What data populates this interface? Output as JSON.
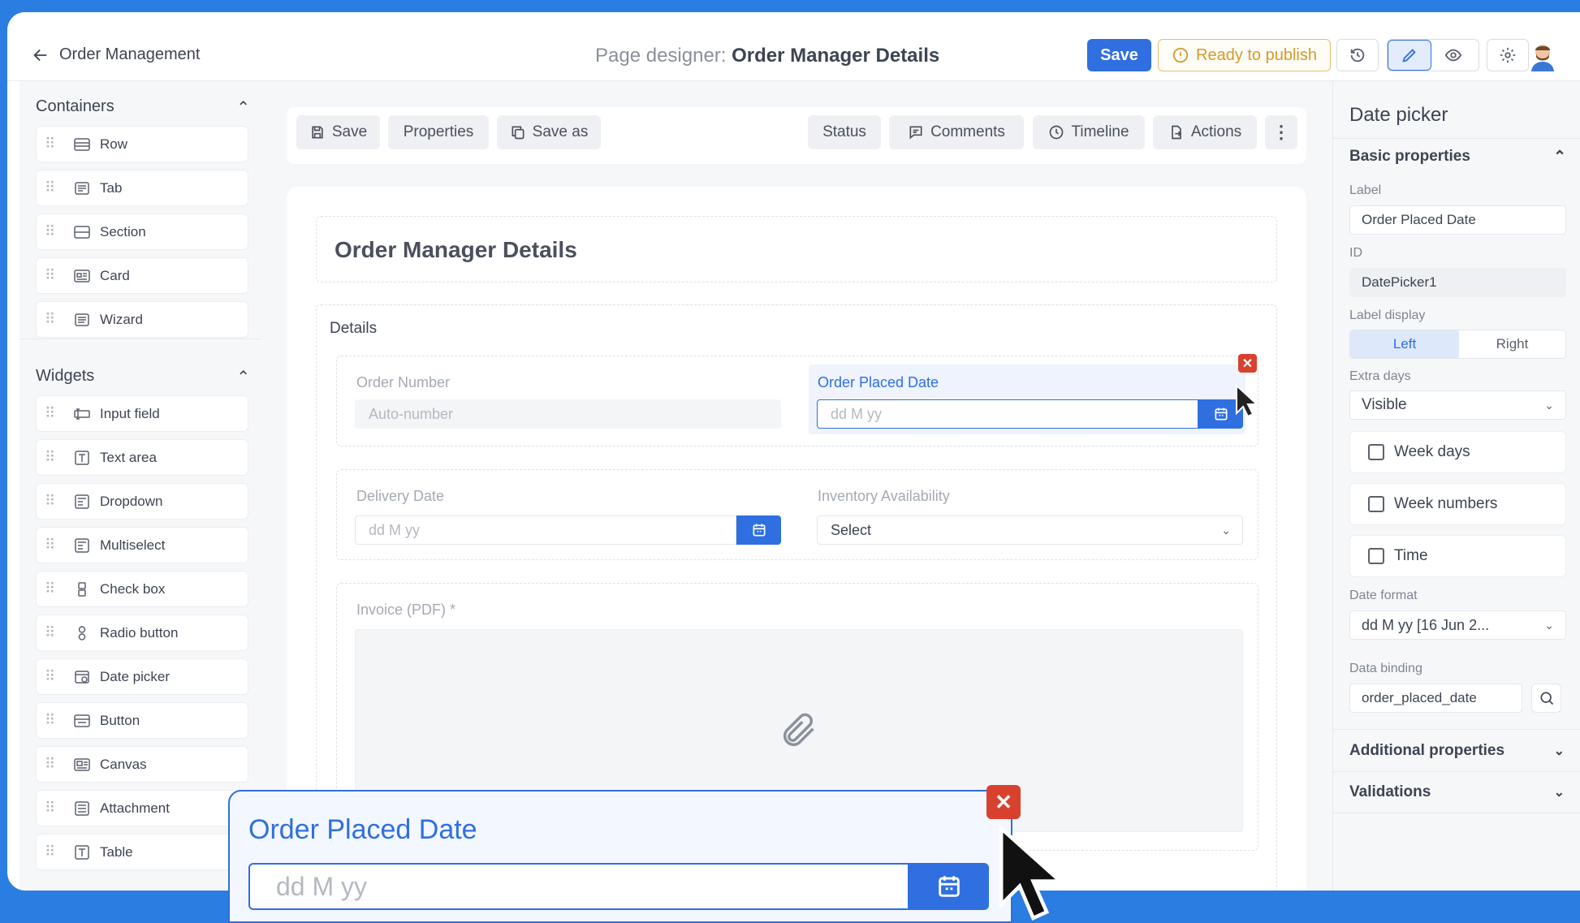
{
  "header": {
    "back_label": "Order Management",
    "title_prefix": "Page designer:",
    "title_name": "Order Manager Details",
    "save_label": "Save",
    "ready_label": "Ready to publish"
  },
  "left_panel": {
    "containers_title": "Containers",
    "containers": [
      {
        "label": "Row",
        "icon": "row-icon"
      },
      {
        "label": "Tab",
        "icon": "tab-icon"
      },
      {
        "label": "Section",
        "icon": "section-icon"
      },
      {
        "label": "Card",
        "icon": "card-icon"
      },
      {
        "label": "Wizard",
        "icon": "wizard-icon"
      }
    ],
    "widgets_title": "Widgets",
    "widgets": [
      {
        "label": "Input field",
        "icon": "input-field-icon"
      },
      {
        "label": "Text area",
        "icon": "text-area-icon"
      },
      {
        "label": "Dropdown",
        "icon": "dropdown-icon"
      },
      {
        "label": "Multiselect",
        "icon": "multiselect-icon"
      },
      {
        "label": "Check box",
        "icon": "checkbox-icon"
      },
      {
        "label": "Radio button",
        "icon": "radio-icon"
      },
      {
        "label": "Date picker",
        "icon": "date-picker-icon"
      },
      {
        "label": "Button",
        "icon": "button-icon"
      },
      {
        "label": "Canvas",
        "icon": "canvas-icon"
      },
      {
        "label": "Attachment",
        "icon": "attachment-icon"
      },
      {
        "label": "Table",
        "icon": "table-icon"
      }
    ]
  },
  "toolbar": {
    "save": "Save",
    "properties": "Properties",
    "save_as": "Save as",
    "status": "Status",
    "comments": "Comments",
    "timeline": "Timeline",
    "actions": "Actions"
  },
  "form": {
    "title": "Order Manager Details",
    "section_label": "Details",
    "order_number_label": "Order Number",
    "order_number_placeholder": "Auto-number",
    "order_placed_label": "Order Placed Date",
    "order_placed_placeholder": "dd M yy",
    "delivery_label": "Delivery Date",
    "delivery_placeholder": "dd M yy",
    "inventory_label": "Inventory Availability",
    "inventory_value": "Select",
    "invoice_label": "Invoice (PDF) *"
  },
  "properties": {
    "title": "Date picker",
    "basic_title": "Basic properties",
    "label_caption": "Label",
    "label_value": "Order Placed Date",
    "id_caption": "ID",
    "id_value": "DatePicker1",
    "label_display_caption": "Label display",
    "label_display_left": "Left",
    "label_display_right": "Right",
    "extra_days_caption": "Extra days",
    "extra_days_value": "Visible",
    "week_days": "Week days",
    "week_numbers": "Week numbers",
    "time": "Time",
    "date_format_caption": "Date format",
    "date_format_value": "dd M yy [16 Jun 2...",
    "data_binding_caption": "Data binding",
    "data_binding_value": "order_placed_date",
    "additional_title": "Additional properties",
    "validations_title": "Validations"
  },
  "zoom_callout": {
    "label": "Order Placed Date",
    "placeholder": "dd M yy"
  },
  "colors": {
    "accent": "#2f6fe0",
    "background": "#2a7de1",
    "warning": "#d49a2a",
    "danger": "#d9412f"
  }
}
